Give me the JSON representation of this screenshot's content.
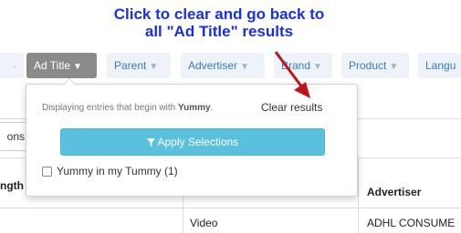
{
  "annotation": {
    "line1": "Click to clear and go back to",
    "line2": "all \"Ad Title\" results",
    "color": "#1a2fe0"
  },
  "filter_tabs": {
    "partial_left": "-",
    "ad_title": "Ad Title",
    "parent": "Parent",
    "advertiser": "Advertiser",
    "brand": "Brand",
    "product": "Product",
    "language_partial": "Langu"
  },
  "dropdown": {
    "info_prefix": "Displaying entries that begin with",
    "info_term": "Yummy",
    "info_suffix": ".",
    "clear_results": "Clear results",
    "apply_label": "Apply Selections",
    "options": [
      {
        "label": "Yummy in my Tummy (1)",
        "checked": false
      }
    ]
  },
  "background": {
    "side_button_partial": "ons",
    "col_header_partial": "ngth",
    "col_header_advertiser": "Advertiser",
    "row1_type": "Video",
    "row1_advertiser": "ADHL CONSUME"
  },
  "colors": {
    "active_tab": "#8a8a8a",
    "apply_button": "#5bc0de",
    "annotation_arrow": "#c0141c"
  }
}
